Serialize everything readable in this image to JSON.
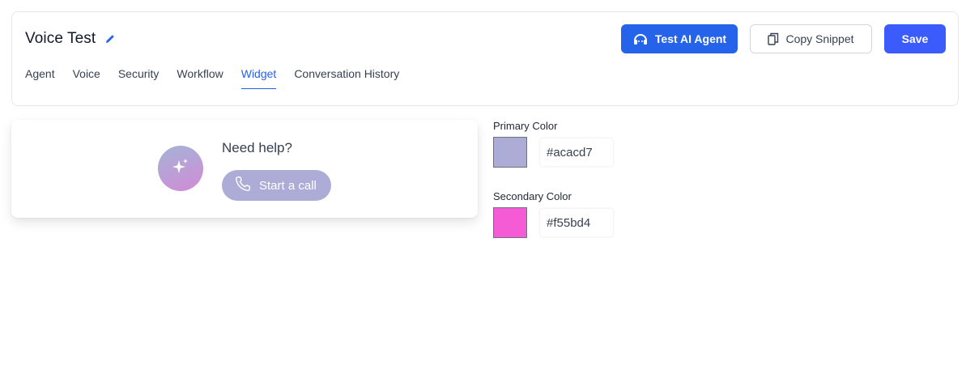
{
  "header": {
    "title": "Voice Test",
    "tabs": [
      {
        "label": "Agent"
      },
      {
        "label": "Voice"
      },
      {
        "label": "Security"
      },
      {
        "label": "Workflow"
      },
      {
        "label": "Widget",
        "active": true
      },
      {
        "label": "Conversation History"
      }
    ],
    "actions": {
      "test_label": "Test AI Agent",
      "copy_label": "Copy Snippet",
      "save_label": "Save"
    }
  },
  "preview": {
    "heading": "Need help?",
    "call_label": "Start a call"
  },
  "colors": {
    "primary": {
      "label": "Primary Color",
      "value": "#acacd7"
    },
    "secondary": {
      "label": "Secondary Color",
      "value": "#f55bd4"
    }
  },
  "theme": {
    "accent": "#2563eb",
    "save": "#3b5bfd"
  },
  "icons": {
    "edit": "pencil-icon",
    "test": "headset-icon",
    "copy": "copy-icon",
    "orb": "sparkle-icon",
    "call": "phone-icon"
  }
}
